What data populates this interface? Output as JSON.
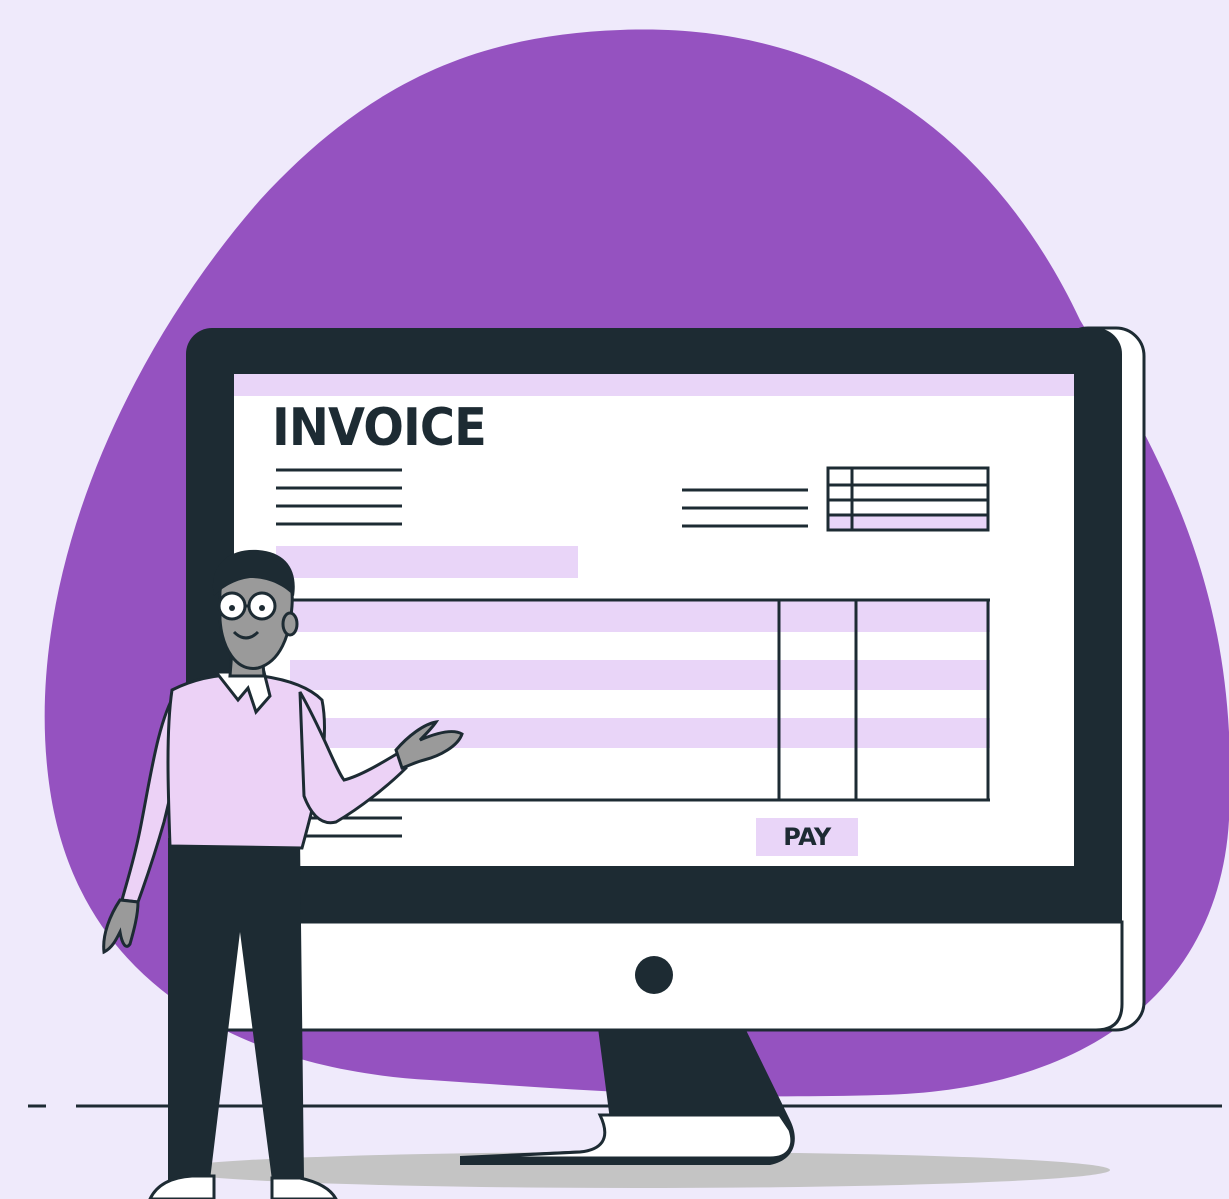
{
  "invoice": {
    "title": "INVOICE",
    "pay_label": "PAY"
  },
  "colors": {
    "background": "#efeafb",
    "blob": "#9552c0",
    "monitor_frame": "#1d2b33",
    "highlight": "#e9d5f8",
    "screen": "#ffffff",
    "shirt": "#ecd2f6",
    "skin": "#9a9a9a"
  }
}
